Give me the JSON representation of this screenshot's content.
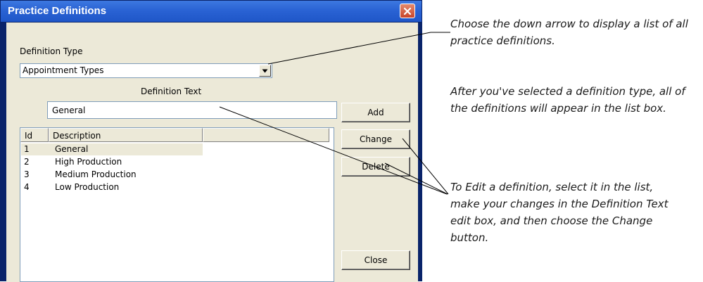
{
  "window": {
    "title": "Practice Definitions"
  },
  "form": {
    "definition_type_label": "Definition Type",
    "definition_type_value": "Appointment Types",
    "definition_text_label": "Definition Text",
    "definition_text_value": "General"
  },
  "list": {
    "columns": [
      "Id",
      "Description"
    ],
    "rows": [
      {
        "id": "1",
        "description": "General",
        "selected": true
      },
      {
        "id": "2",
        "description": "High Production",
        "selected": false
      },
      {
        "id": "3",
        "description": "Medium Production",
        "selected": false
      },
      {
        "id": "4",
        "description": "Low Production",
        "selected": false
      }
    ]
  },
  "buttons": {
    "add": "Add",
    "change": "Change",
    "delete": "Delete",
    "close": "Close"
  },
  "annotations": {
    "down_arrow": "Choose the down arrow to display a list of all practice definitions.",
    "list_box": "After you've selected a definition type, all of the definitions will appear in the list box.",
    "edit": "To Edit a definition, select it in the list, make your changes in the Definition Text edit box, and then choose the Change button."
  }
}
